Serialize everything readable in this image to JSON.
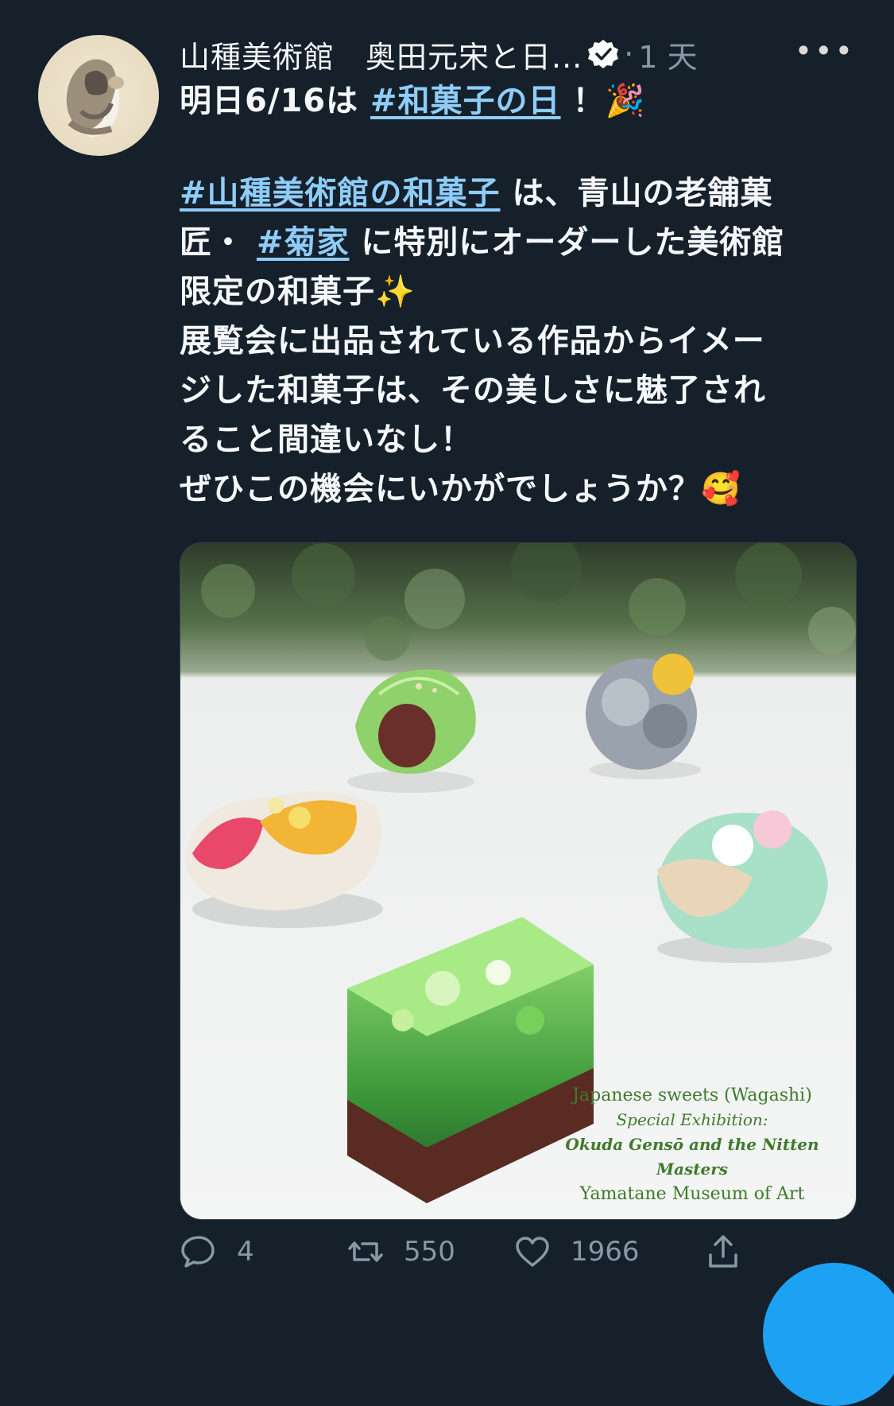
{
  "tweet": {
    "display_name": "山種美術館　奥田元宋と日...",
    "dot": "·",
    "time": "1 天",
    "more": "•••",
    "lines": {
      "l1_text": "明日6/16は ",
      "l1_tag": "#和菓子の日",
      "l1_after": " ！",
      "l1_emoji": "🎉",
      "l2_tag": "#山種美術館の和菓子",
      "l2_after": " は、青山の老舗菓",
      "l3_text": "匠・ ",
      "l3_tag": "#菊家",
      "l3_after": " に特別にオーダーした美術館",
      "l4_text": "限定の和菓子",
      "l4_emoji": "✨",
      "l5_text": "展覧会に出品されている作品からイメー",
      "l6_text": "ジした和菓子は、その美しさに魅了され",
      "l7_text": "ること間違いなし！",
      "l8_text": "ぜひこの機会にいかがでしょうか？",
      "l8_emoji": "🥰"
    }
  },
  "media": {
    "caption_line1": "Japanese sweets (Wagashi)",
    "caption_line2": "Special Exhibition:",
    "caption_line3": "Okuda Gensō and the Nitten Masters",
    "caption_line4": "Yamatane Museum of Art"
  },
  "actions": {
    "reply_count": "4",
    "retweet_count": "550",
    "like_count": "1966"
  },
  "colors": {
    "background": "#15202b",
    "link": "#8ecdf8",
    "secondary": "#8899a6",
    "fab": "#1da1f2"
  }
}
